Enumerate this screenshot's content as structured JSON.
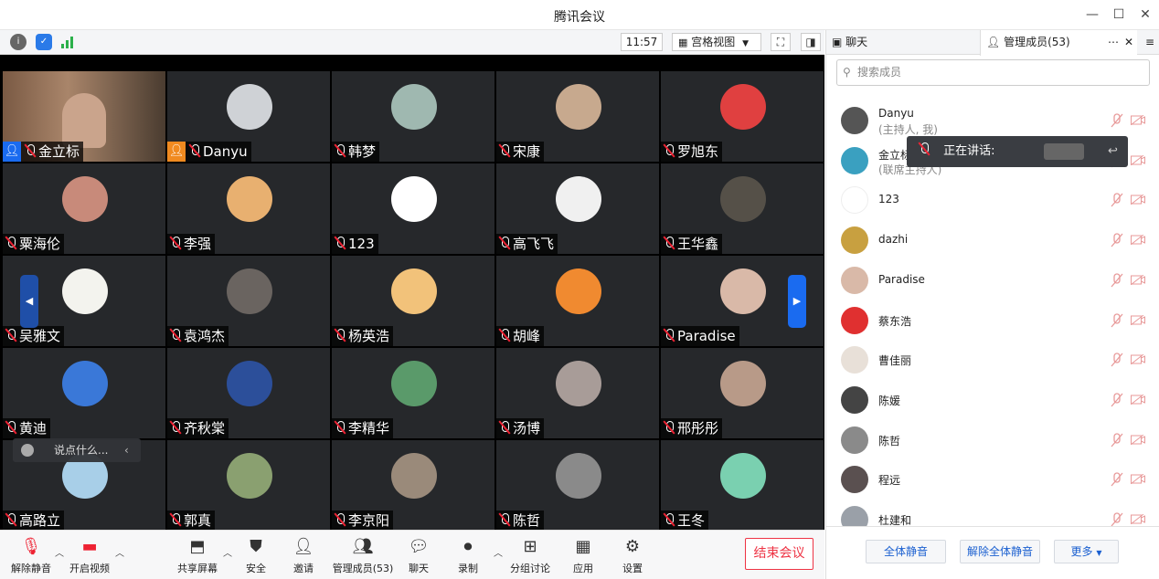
{
  "window": {
    "title": "腾讯会议"
  },
  "toolbar": {
    "time": "11:57",
    "view_label": "宫格视图"
  },
  "participants": [
    {
      "name": "金立标",
      "host": true,
      "color": "#8a6a4a"
    },
    {
      "name": "Danyu",
      "host": true,
      "color": "#cfd2d6"
    },
    {
      "name": "韩梦",
      "host": false,
      "color": "#9fb8b0"
    },
    {
      "name": "宋康",
      "host": false,
      "color": "#c7a98e"
    },
    {
      "name": "罗旭东",
      "host": false,
      "color": "#e04040"
    },
    {
      "name": "粟海伦",
      "host": false,
      "color": "#c88a7a"
    },
    {
      "name": "李强",
      "host": false,
      "color": "#e8b070"
    },
    {
      "name": "123",
      "host": false,
      "color": "#ffffff"
    },
    {
      "name": "高飞飞",
      "host": false,
      "color": "#f0f0f0"
    },
    {
      "name": "王华鑫",
      "host": false,
      "color": "#555048"
    },
    {
      "name": "吴雅文",
      "host": false,
      "color": "#f3f3ee"
    },
    {
      "name": "袁鸿杰",
      "host": false,
      "color": "#6a6460"
    },
    {
      "name": "杨英浩",
      "host": false,
      "color": "#f2c27a"
    },
    {
      "name": "胡峰",
      "host": false,
      "color": "#f08a30"
    },
    {
      "name": "Paradise",
      "host": false,
      "color": "#d9b9a8"
    },
    {
      "name": "黄迪",
      "host": false,
      "color": "#3a78d8"
    },
    {
      "name": "齐秋棠",
      "host": false,
      "color": "#2c4f9a"
    },
    {
      "name": "李精华",
      "host": false,
      "color": "#5a9a6a"
    },
    {
      "name": "汤博",
      "host": false,
      "color": "#a89c98"
    },
    {
      "name": "邢彤彤",
      "host": false,
      "color": "#b89a88"
    },
    {
      "name": "高路立",
      "host": false,
      "color": "#a8cfe8"
    },
    {
      "name": "郭真",
      "host": false,
      "color": "#8aa070"
    },
    {
      "name": "李京阳",
      "host": false,
      "color": "#9a8a7a"
    },
    {
      "name": "陈哲",
      "host": false,
      "color": "#8a8a8a"
    },
    {
      "name": "王冬",
      "host": false,
      "color": "#7ad0b0"
    }
  ],
  "chat_input": {
    "placeholder": "说点什么..."
  },
  "bottom": {
    "mute": "解除静音",
    "video": "开启视频",
    "share": "共享屏幕",
    "security": "安全",
    "invite": "邀请",
    "members": "管理成员(53)",
    "chat": "聊天",
    "record": "录制",
    "breakout": "分组讨论",
    "apps": "应用",
    "settings": "设置",
    "end": "结束会议"
  },
  "panel": {
    "tab_chat": "聊天",
    "tab_members": "管理成员(53)",
    "search_placeholder": "搜索成员",
    "speaking": "正在讲话:",
    "members": [
      {
        "name": "Danyu",
        "sub": "(主持人, 我)",
        "color": "#555"
      },
      {
        "name": "金立标",
        "sub": "(联席主持人)",
        "color": "#3aa0c0"
      },
      {
        "name": "123",
        "sub": "",
        "color": "#fff"
      },
      {
        "name": "dazhi",
        "sub": "",
        "color": "#c8a040"
      },
      {
        "name": "Paradise",
        "sub": "",
        "color": "#d9b9a8"
      },
      {
        "name": "蔡东浩",
        "sub": "",
        "color": "#e03030"
      },
      {
        "name": "曹佳丽",
        "sub": "",
        "color": "#e8e0d8"
      },
      {
        "name": "陈媛",
        "sub": "",
        "color": "#444"
      },
      {
        "name": "陈哲",
        "sub": "",
        "color": "#8a8a8a"
      },
      {
        "name": "程远",
        "sub": "",
        "color": "#5a5050"
      },
      {
        "name": "杜建和",
        "sub": "",
        "color": "#9aa0a8"
      }
    ],
    "mute_all": "全体静音",
    "unmute_all": "解除全体静音",
    "more": "更多"
  }
}
